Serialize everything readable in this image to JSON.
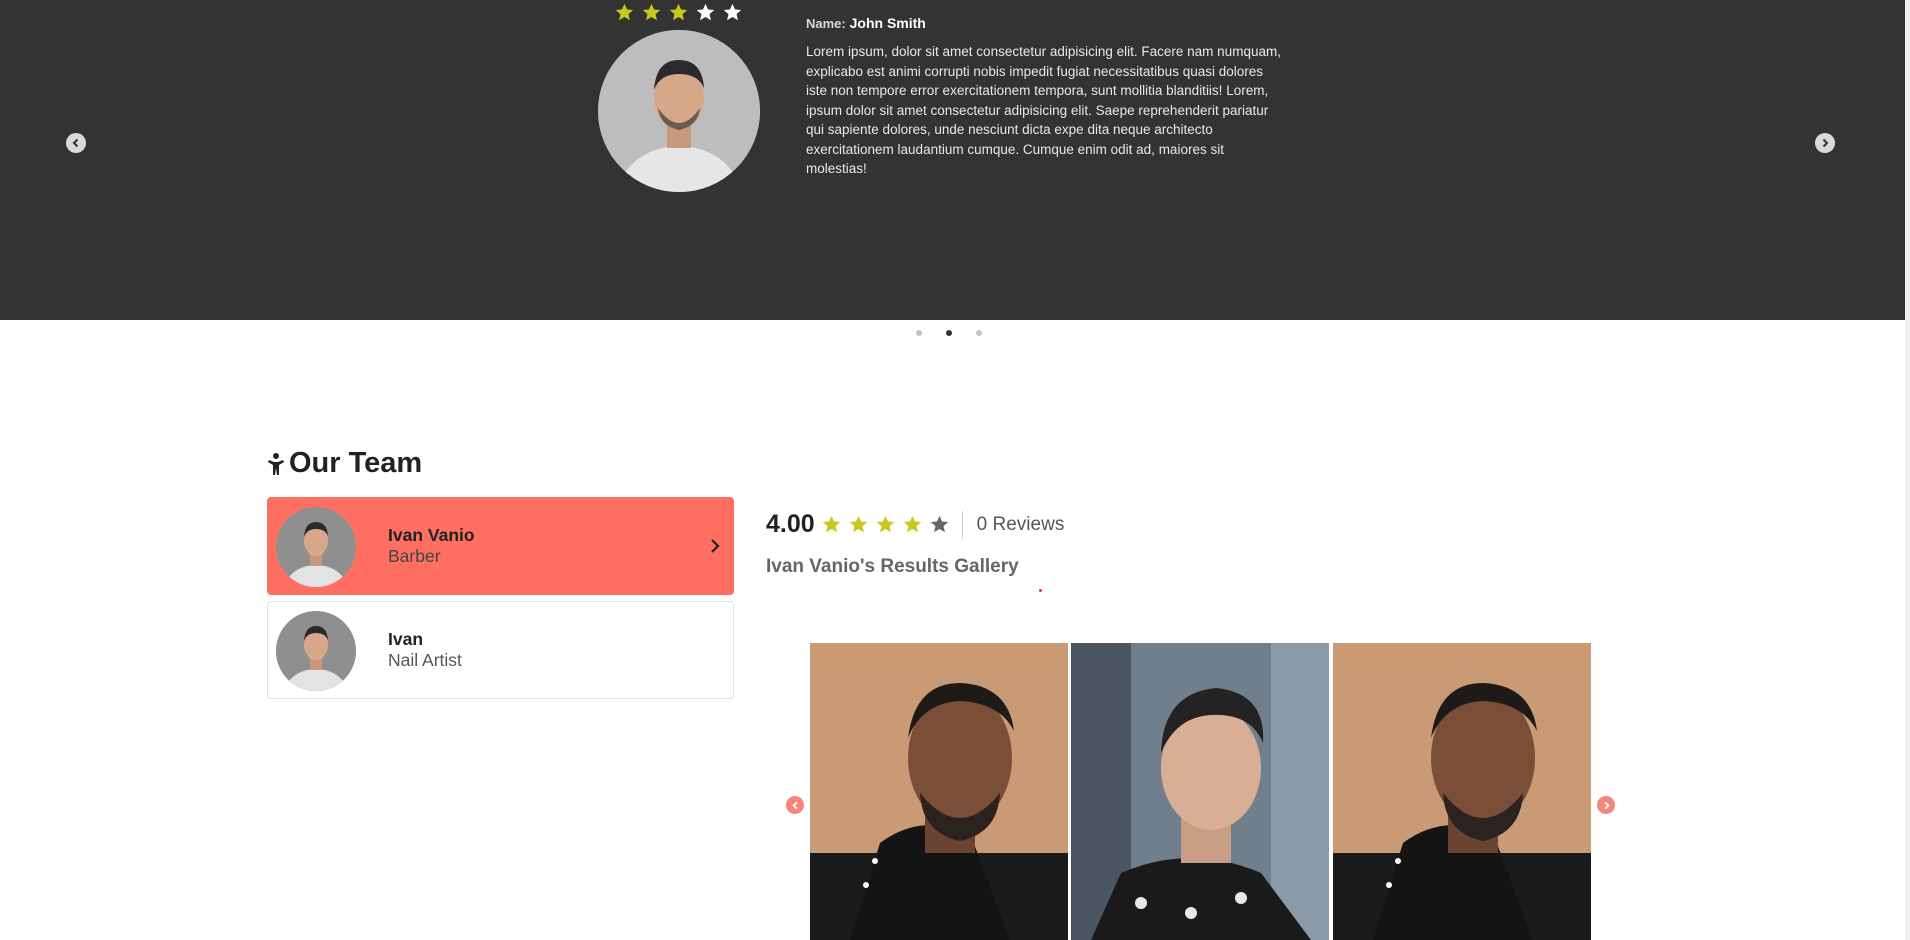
{
  "testimonial": {
    "rating": 3,
    "stars_total": 5,
    "star_filled_color": "#c8c81e",
    "star_empty_color": "#ffffff",
    "name_label": "Name:",
    "name": "John Smith",
    "body": "Lorem ipsum, dolor sit amet consectetur adipisicing elit. Facere nam numquam, explicabo est animi corrupti nobis impedit fugiat necessitatibus quasi dolores iste non tempore error exercitationem tempora, sunt mollitia blanditiis! Lorem, ipsum dolor sit amet consectetur adipisicing elit. Saepe reprehenderit pariatur qui sapiente dolores, unde nesciunt dicta expe dita neque architecto exercitationem laudantium cumque. Cumque enim odit ad, maiores sit molestias!",
    "prev_icon": "chevron-left-icon",
    "next_icon": "chevron-right-icon",
    "slides": 3,
    "active_slide": 2
  },
  "team": {
    "title": "Our Team",
    "title_icon": "person-icon",
    "members": [
      {
        "name": "Ivan Vanio",
        "role": "Barber",
        "active": true
      },
      {
        "name": "Ivan",
        "role": "Nail Artist",
        "active": false
      }
    ],
    "accent_color": "#ff6f61"
  },
  "profile": {
    "rating_value": "4.00",
    "rating": 4,
    "stars_total": 5,
    "reviews_label": "0 Reviews",
    "gallery_title": "Ivan Vanio's Results Gallery",
    "gallery_prev_icon": "chevron-left-icon",
    "gallery_next_icon": "chevron-right-icon",
    "photos": [
      "haircut-side-profile-1",
      "haircut-side-profile-2",
      "haircut-side-profile-3"
    ]
  }
}
